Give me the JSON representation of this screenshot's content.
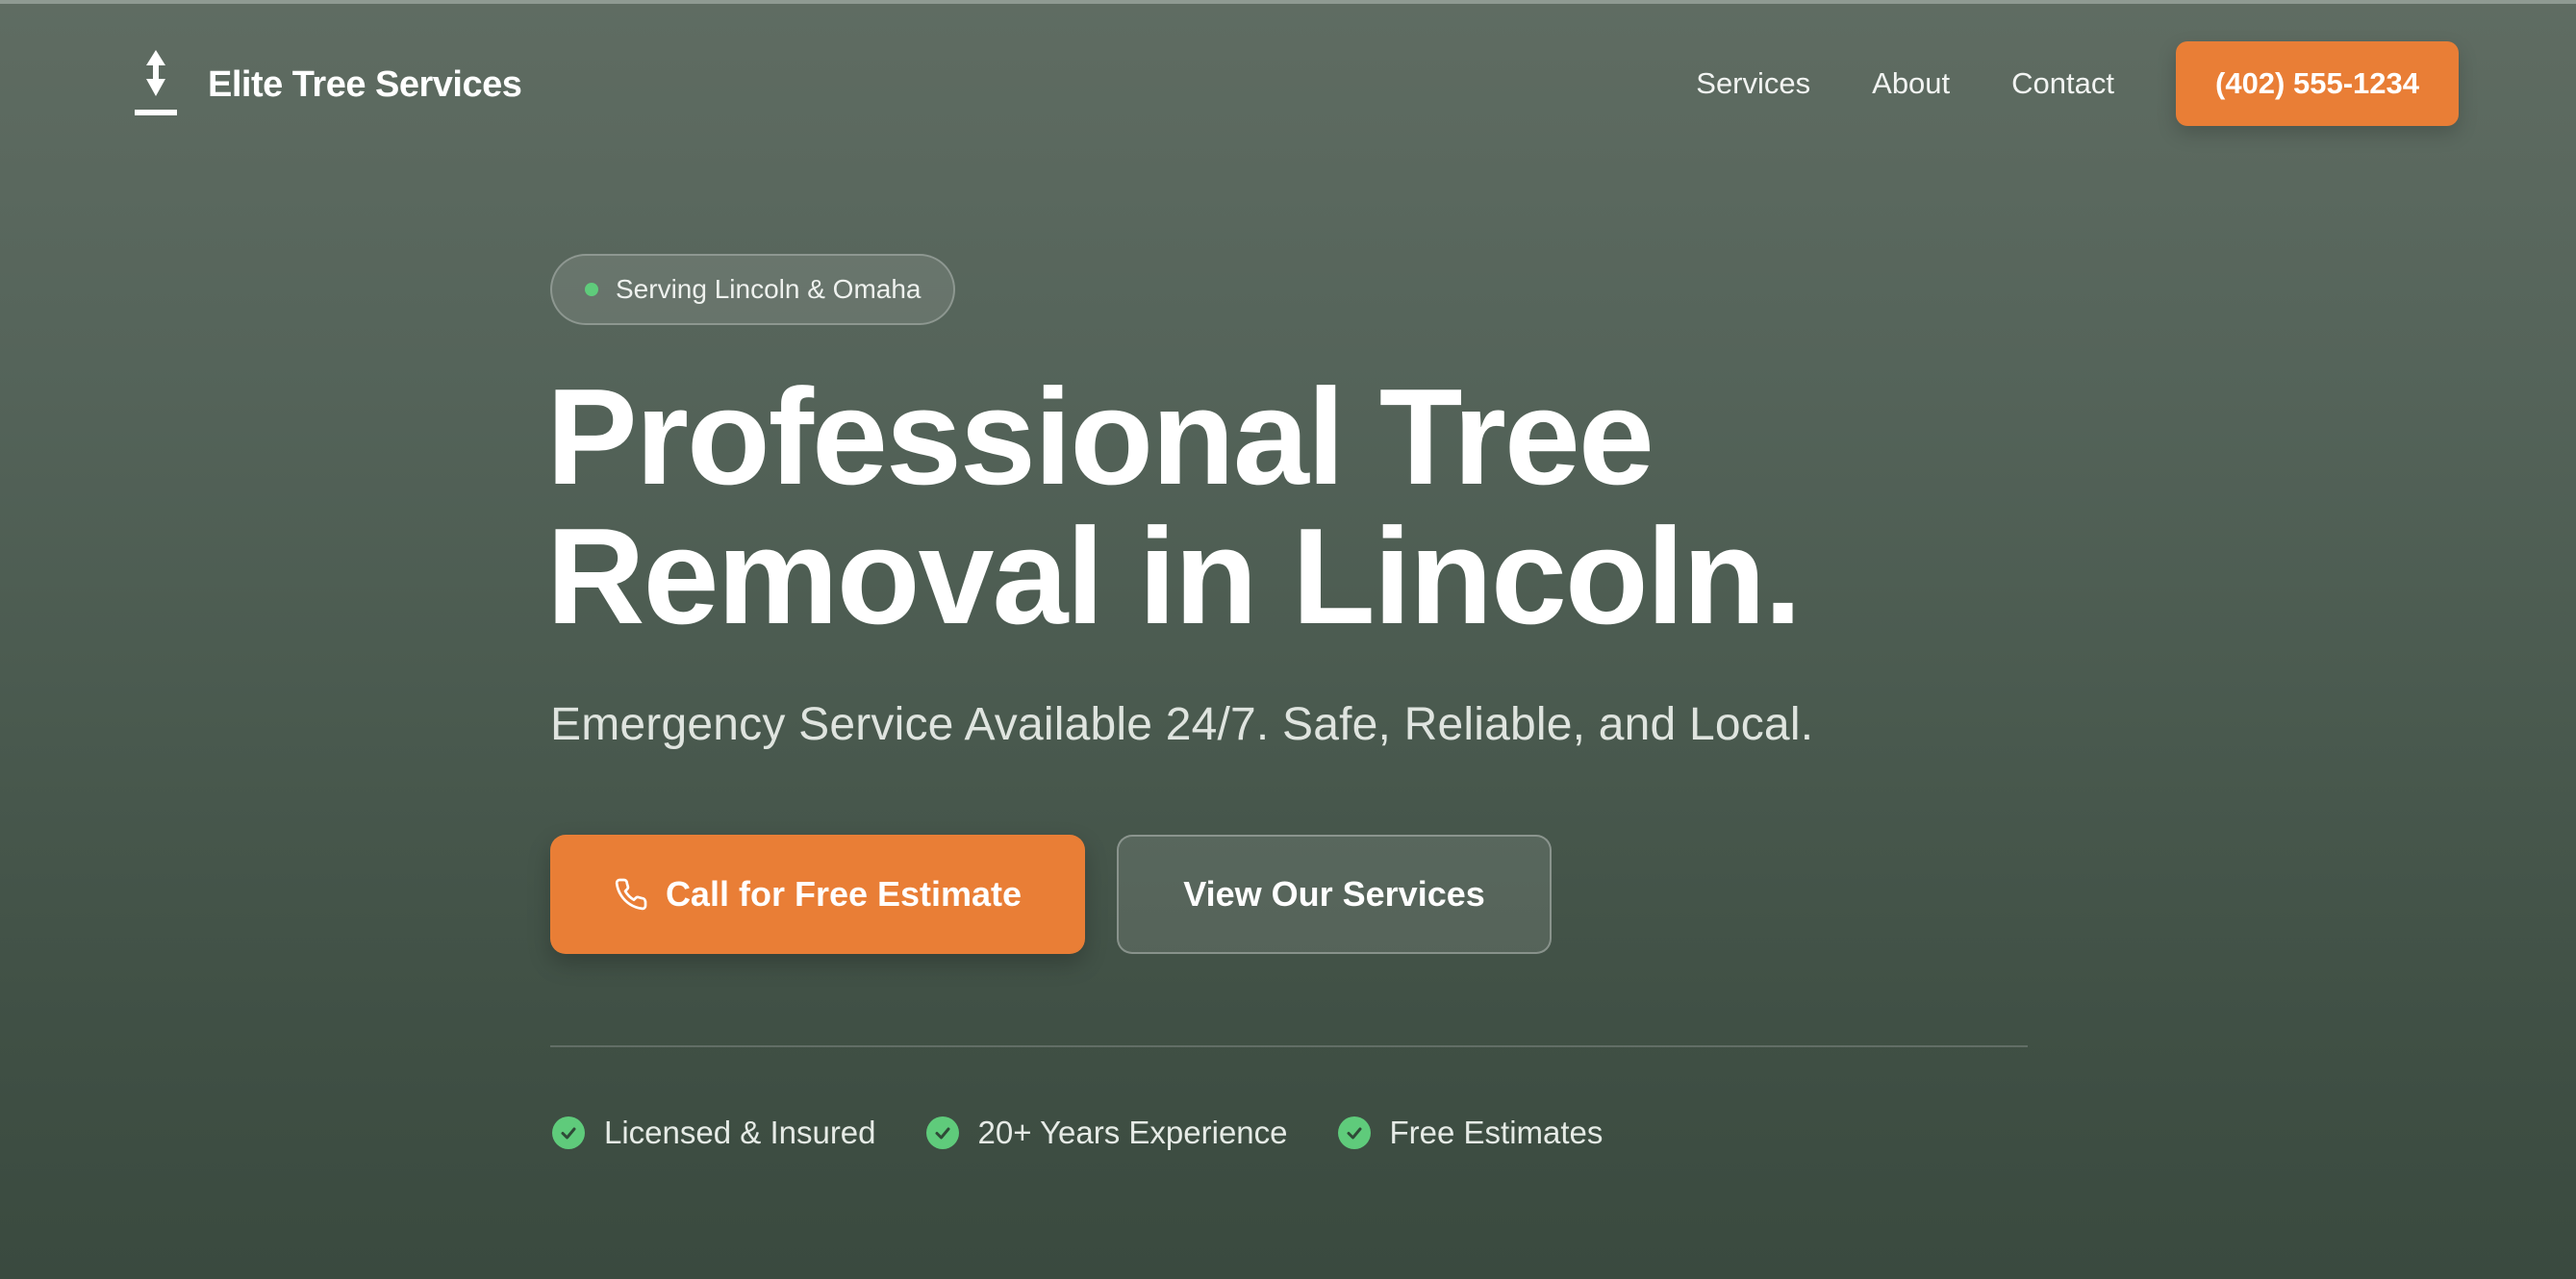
{
  "brand": {
    "name": "Elite Tree Services",
    "logo_icon": "tree-arrow-icon"
  },
  "nav": {
    "links": [
      "Services",
      "About",
      "Contact"
    ],
    "phone_label": "(402) 555-1234"
  },
  "hero": {
    "badge_text": "Serving Lincoln & Omaha",
    "headline_line1": "Professional Tree",
    "headline_line2": "Removal in Lincoln.",
    "subheadline": "Emergency Service Available 24/7. Safe, Reliable, and Local.",
    "cta_primary": "Call for Free Estimate",
    "cta_secondary": "View Our Services",
    "trust_items": [
      "Licensed & Insured",
      "20+ Years Experience",
      "Free Estimates"
    ]
  },
  "colors": {
    "accent": "#e97e36",
    "check": "#5fcb7b",
    "background_top": "#5f6c62",
    "background_bottom": "#3a4a3f"
  }
}
